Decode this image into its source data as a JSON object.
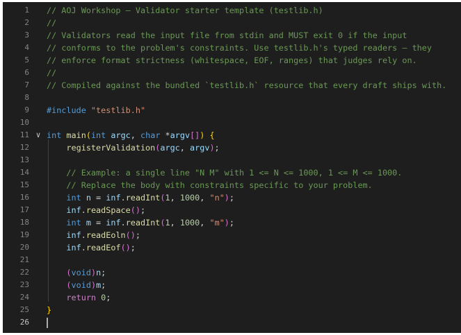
{
  "editor": {
    "lines": [
      {
        "n": "1",
        "tokens": [
          {
            "t": "// AOJ Workshop — Validator starter template (testlib.h)",
            "c": "com"
          }
        ]
      },
      {
        "n": "2",
        "tokens": [
          {
            "t": "//",
            "c": "com"
          }
        ]
      },
      {
        "n": "3",
        "tokens": [
          {
            "t": "// Validators read the input file from stdin and MUST exit 0 if the input",
            "c": "com"
          }
        ]
      },
      {
        "n": "4",
        "tokens": [
          {
            "t": "// conforms to the problem's constraints. Use testlib.h's typed readers — they",
            "c": "com"
          }
        ]
      },
      {
        "n": "5",
        "tokens": [
          {
            "t": "// enforce format strictness (whitespace, EOF, ranges) that judges rely on.",
            "c": "com"
          }
        ]
      },
      {
        "n": "6",
        "tokens": [
          {
            "t": "//",
            "c": "com"
          }
        ]
      },
      {
        "n": "7",
        "tokens": [
          {
            "t": "// Compiled against the bundled `testlib.h` resource that every draft ships with.",
            "c": "com"
          }
        ]
      },
      {
        "n": "8",
        "tokens": []
      },
      {
        "n": "9",
        "tokens": [
          {
            "t": "#include ",
            "c": "kw"
          },
          {
            "t": "\"testlib.h\"",
            "c": "str"
          }
        ]
      },
      {
        "n": "10",
        "tokens": []
      },
      {
        "n": "11",
        "fold": "chevron-down",
        "tokens": [
          {
            "t": "int ",
            "c": "kw"
          },
          {
            "t": "main",
            "c": "fn"
          },
          {
            "t": "(",
            "c": "br1"
          },
          {
            "t": "int ",
            "c": "kw"
          },
          {
            "t": "argc",
            "c": "var"
          },
          {
            "t": ", ",
            "c": "pun"
          },
          {
            "t": "char ",
            "c": "kw"
          },
          {
            "t": "*",
            "c": "pun"
          },
          {
            "t": "argv",
            "c": "var"
          },
          {
            "t": "[]",
            "c": "br2"
          },
          {
            "t": ")",
            "c": "br1"
          },
          {
            "t": " ",
            "c": "pun"
          },
          {
            "t": "{",
            "c": "br1"
          }
        ]
      },
      {
        "n": "12",
        "tokens": [
          {
            "t": "    ",
            "c": "pun"
          },
          {
            "t": "registerValidation",
            "c": "fn"
          },
          {
            "t": "(",
            "c": "br2"
          },
          {
            "t": "argc",
            "c": "var"
          },
          {
            "t": ", ",
            "c": "pun"
          },
          {
            "t": "argv",
            "c": "var"
          },
          {
            "t": ")",
            "c": "br2"
          },
          {
            "t": ";",
            "c": "pun"
          }
        ]
      },
      {
        "n": "13",
        "tokens": []
      },
      {
        "n": "14",
        "tokens": [
          {
            "t": "    // Example: a single line \"N M\" with 1 <= N <= 1000, 1 <= M <= 1000.",
            "c": "com"
          }
        ]
      },
      {
        "n": "15",
        "tokens": [
          {
            "t": "    // Replace the body with constraints specific to your problem.",
            "c": "com"
          }
        ]
      },
      {
        "n": "16",
        "tokens": [
          {
            "t": "    ",
            "c": "pun"
          },
          {
            "t": "int ",
            "c": "kw"
          },
          {
            "t": "n",
            "c": "var"
          },
          {
            "t": " = ",
            "c": "pun"
          },
          {
            "t": "inf",
            "c": "var"
          },
          {
            "t": ".",
            "c": "pun"
          },
          {
            "t": "readInt",
            "c": "fn"
          },
          {
            "t": "(",
            "c": "br2"
          },
          {
            "t": "1",
            "c": "num"
          },
          {
            "t": ", ",
            "c": "pun"
          },
          {
            "t": "1000",
            "c": "num"
          },
          {
            "t": ", ",
            "c": "pun"
          },
          {
            "t": "\"n\"",
            "c": "str"
          },
          {
            "t": ")",
            "c": "br2"
          },
          {
            "t": ";",
            "c": "pun"
          }
        ]
      },
      {
        "n": "17",
        "tokens": [
          {
            "t": "    ",
            "c": "pun"
          },
          {
            "t": "inf",
            "c": "var"
          },
          {
            "t": ".",
            "c": "pun"
          },
          {
            "t": "readSpace",
            "c": "fn"
          },
          {
            "t": "()",
            "c": "br2"
          },
          {
            "t": ";",
            "c": "pun"
          }
        ]
      },
      {
        "n": "18",
        "tokens": [
          {
            "t": "    ",
            "c": "pun"
          },
          {
            "t": "int ",
            "c": "kw"
          },
          {
            "t": "m",
            "c": "var"
          },
          {
            "t": " = ",
            "c": "pun"
          },
          {
            "t": "inf",
            "c": "var"
          },
          {
            "t": ".",
            "c": "pun"
          },
          {
            "t": "readInt",
            "c": "fn"
          },
          {
            "t": "(",
            "c": "br2"
          },
          {
            "t": "1",
            "c": "num"
          },
          {
            "t": ", ",
            "c": "pun"
          },
          {
            "t": "1000",
            "c": "num"
          },
          {
            "t": ", ",
            "c": "pun"
          },
          {
            "t": "\"m\"",
            "c": "str"
          },
          {
            "t": ")",
            "c": "br2"
          },
          {
            "t": ";",
            "c": "pun"
          }
        ]
      },
      {
        "n": "19",
        "tokens": [
          {
            "t": "    ",
            "c": "pun"
          },
          {
            "t": "inf",
            "c": "var"
          },
          {
            "t": ".",
            "c": "pun"
          },
          {
            "t": "readEoln",
            "c": "fn"
          },
          {
            "t": "()",
            "c": "br2"
          },
          {
            "t": ";",
            "c": "pun"
          }
        ]
      },
      {
        "n": "20",
        "tokens": [
          {
            "t": "    ",
            "c": "pun"
          },
          {
            "t": "inf",
            "c": "var"
          },
          {
            "t": ".",
            "c": "pun"
          },
          {
            "t": "readEof",
            "c": "fn"
          },
          {
            "t": "()",
            "c": "br2"
          },
          {
            "t": ";",
            "c": "pun"
          }
        ]
      },
      {
        "n": "21",
        "tokens": []
      },
      {
        "n": "22",
        "tokens": [
          {
            "t": "    ",
            "c": "pun"
          },
          {
            "t": "(",
            "c": "br2"
          },
          {
            "t": "void",
            "c": "kw"
          },
          {
            "t": ")",
            "c": "br2"
          },
          {
            "t": "n",
            "c": "var"
          },
          {
            "t": ";",
            "c": "pun"
          }
        ]
      },
      {
        "n": "23",
        "tokens": [
          {
            "t": "    ",
            "c": "pun"
          },
          {
            "t": "(",
            "c": "br2"
          },
          {
            "t": "void",
            "c": "kw"
          },
          {
            "t": ")",
            "c": "br2"
          },
          {
            "t": "m",
            "c": "var"
          },
          {
            "t": ";",
            "c": "pun"
          }
        ]
      },
      {
        "n": "24",
        "tokens": [
          {
            "t": "    ",
            "c": "pun"
          },
          {
            "t": "return ",
            "c": "ctl"
          },
          {
            "t": "0",
            "c": "num"
          },
          {
            "t": ";",
            "c": "pun"
          }
        ]
      },
      {
        "n": "25",
        "tokens": [
          {
            "t": "}",
            "c": "br1"
          }
        ]
      },
      {
        "n": "26",
        "active": true,
        "tokens": []
      }
    ]
  },
  "colors": {
    "background": "#1e1e1e",
    "comment": "#6a9955",
    "keyword": "#569cd6",
    "function": "#dcdcaa",
    "variable": "#9cdcfe",
    "string": "#ce9178",
    "number": "#b5cea8"
  }
}
